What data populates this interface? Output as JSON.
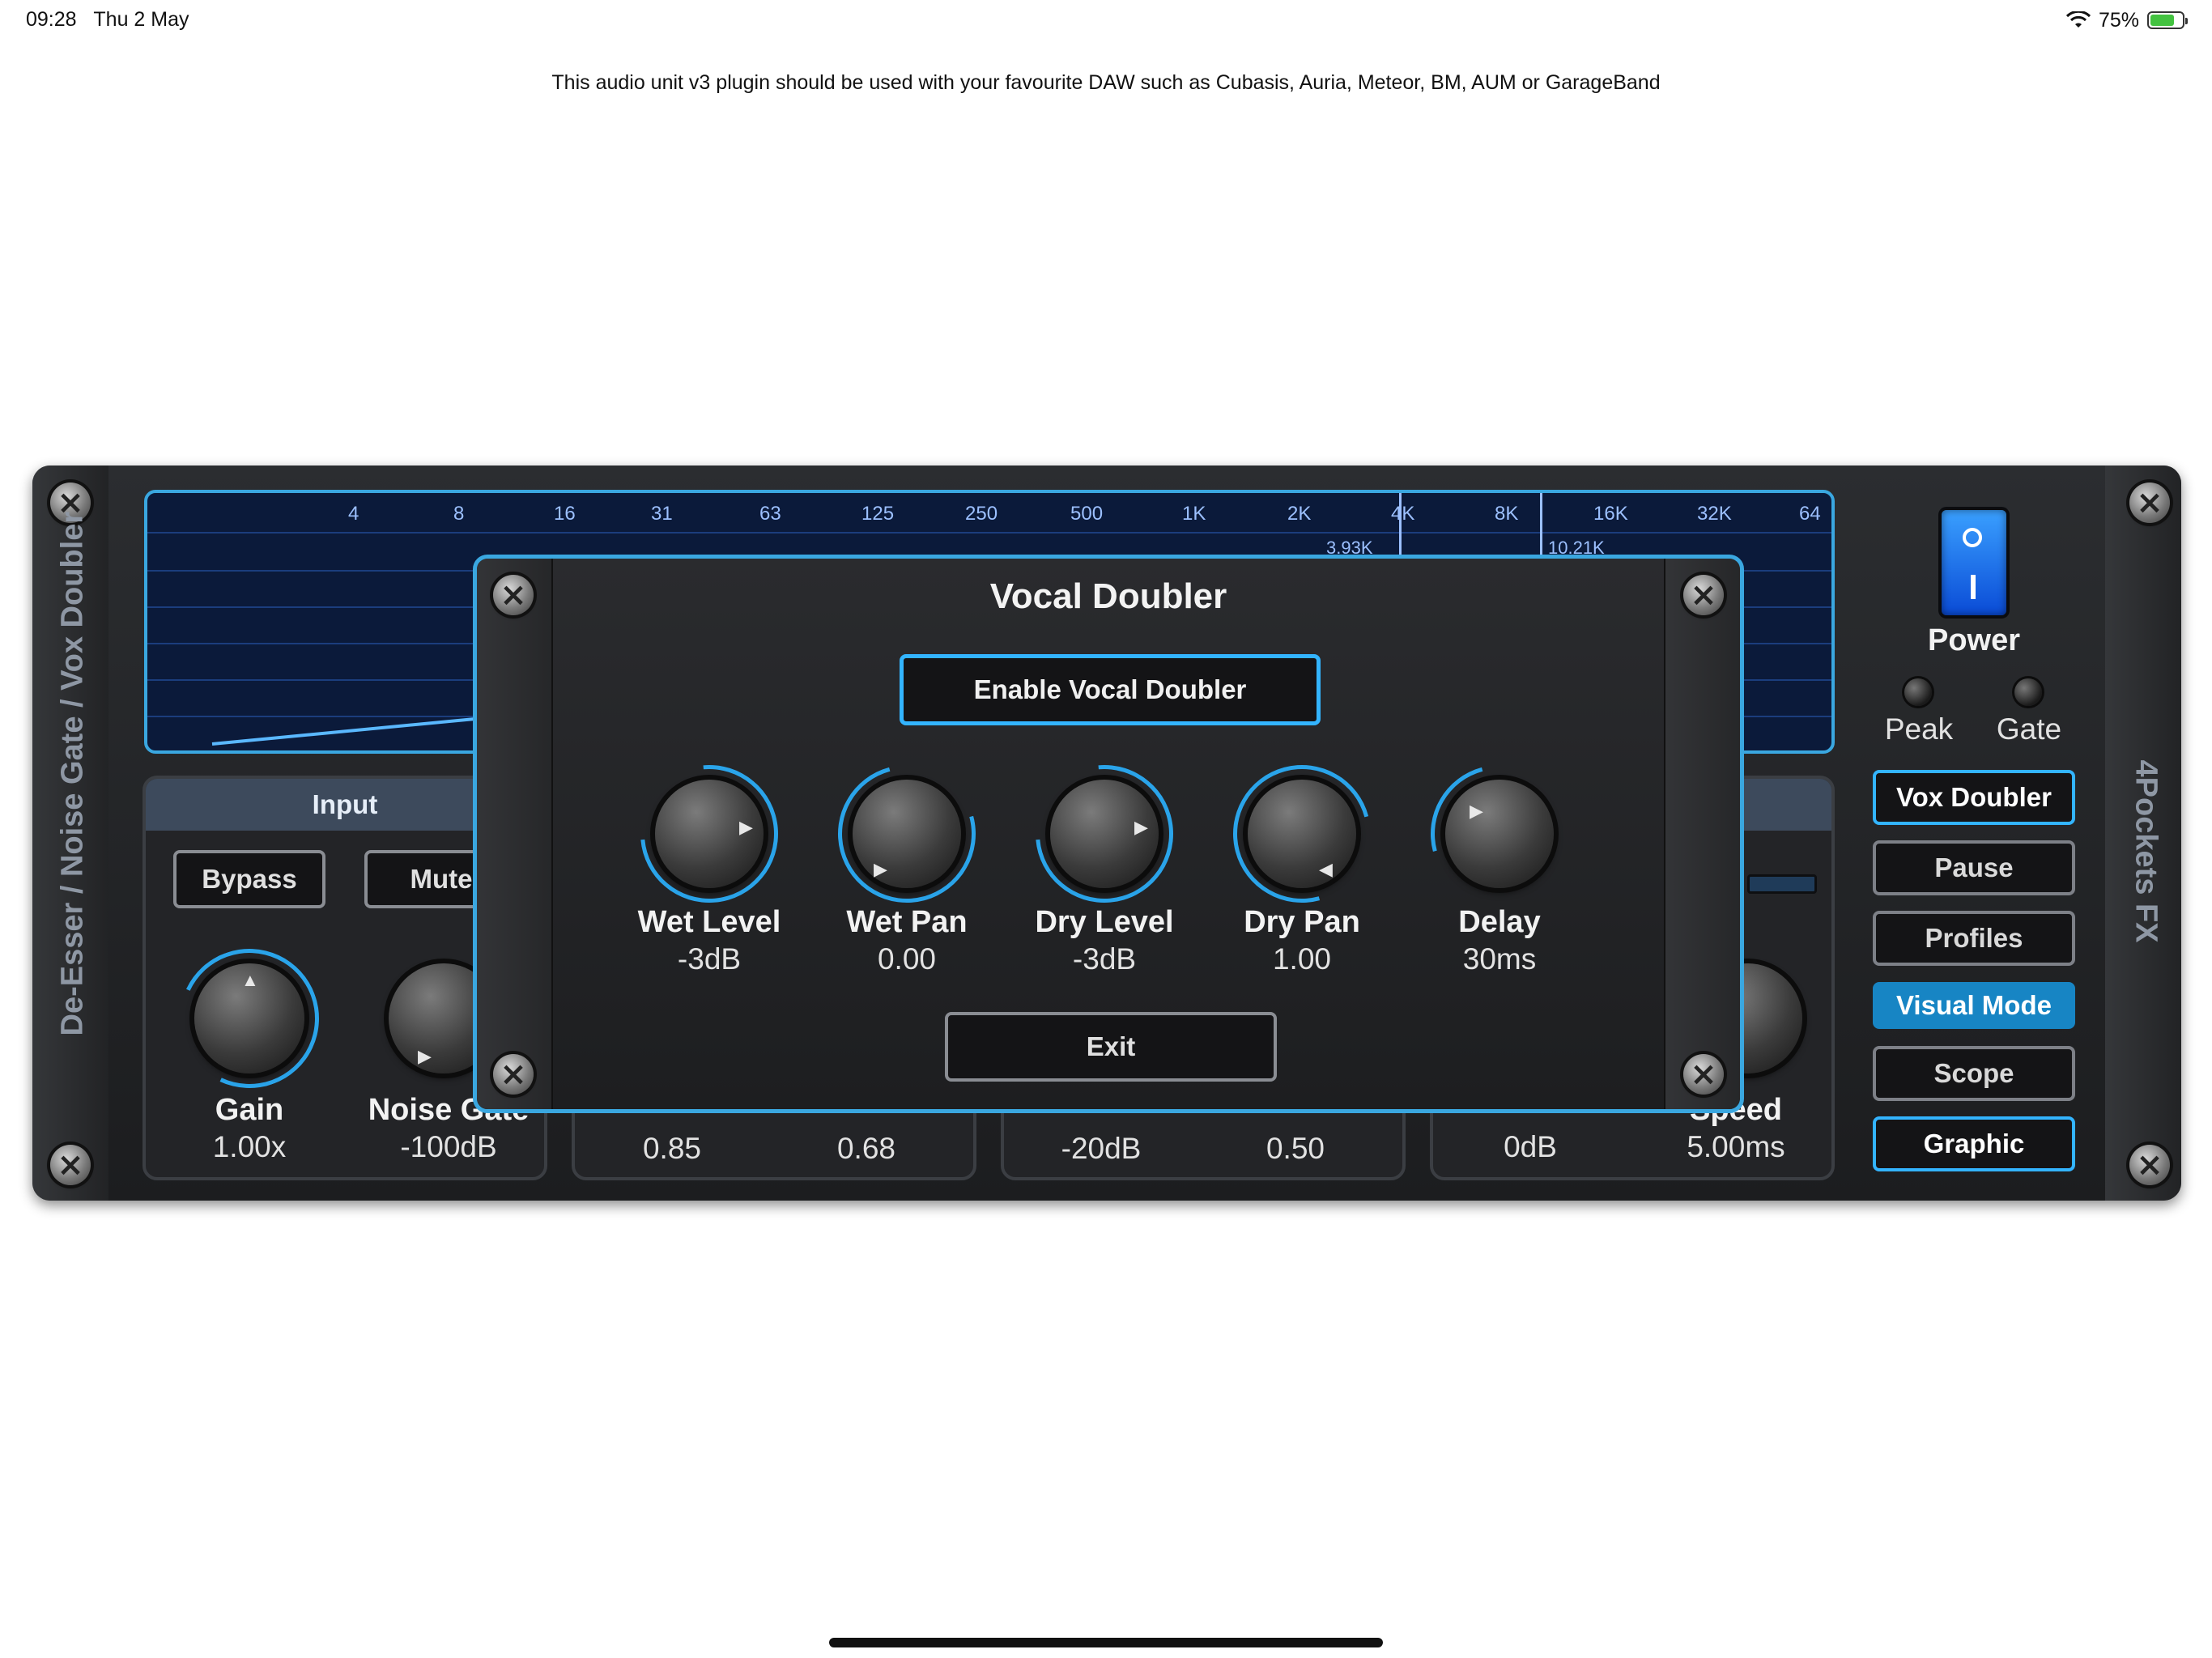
{
  "status_bar": {
    "time": "09:28",
    "date": "Thu 2 May",
    "battery": "75%",
    "battery_level": 0.75
  },
  "notice": "This audio unit v3 plugin should be used with your favourite DAW such as Cubasis, Auria, Meteor, BM, AUM or GarageBand",
  "plugin": {
    "left_title": "De-Esser / Noise Gate / Vox Doubler",
    "right_title": "4Pockets FX",
    "spectrum": {
      "frequencies": [
        "4",
        "8",
        "16",
        "31",
        "63",
        "125",
        "250",
        "500",
        "1K",
        "2K",
        "4K",
        "8K",
        "16K",
        "32K",
        "64"
      ],
      "markers": [
        "3.93K",
        "10.21K"
      ]
    },
    "input_panel": {
      "title": "Input",
      "bypass": "Bypass",
      "mute": "Mute",
      "gain_label": "Gain",
      "gain_value": "1.00x",
      "noise_gate_label": "Noise Gate",
      "noise_gate_value": "-100dB"
    },
    "bottom_values": {
      "lpf_value": "0.85",
      "hpf_value": "0.68",
      "threshold_value": "-20dB",
      "intensity_value": "0.50",
      "limiter_value": "0dB",
      "speed_label": "Speed",
      "speed_value": "5.00ms"
    },
    "power": {
      "label": "Power",
      "peak": "Peak",
      "gate": "Gate"
    },
    "side_buttons": {
      "vox_doubler": "Vox Doubler",
      "pause": "Pause",
      "profiles": "Profiles",
      "visual_mode": "Visual Mode",
      "scope": "Scope",
      "graphic": "Graphic"
    }
  },
  "modal": {
    "title": "Vocal Doubler",
    "enable_button": "Enable Vocal Doubler",
    "knobs": [
      {
        "label": "Wet Level",
        "value": "-3dB"
      },
      {
        "label": "Wet Pan",
        "value": "0.00"
      },
      {
        "label": "Dry Level",
        "value": "-3dB"
      },
      {
        "label": "Dry Pan",
        "value": "1.00"
      },
      {
        "label": "Delay",
        "value": "30ms"
      }
    ],
    "exit_button": "Exit"
  }
}
